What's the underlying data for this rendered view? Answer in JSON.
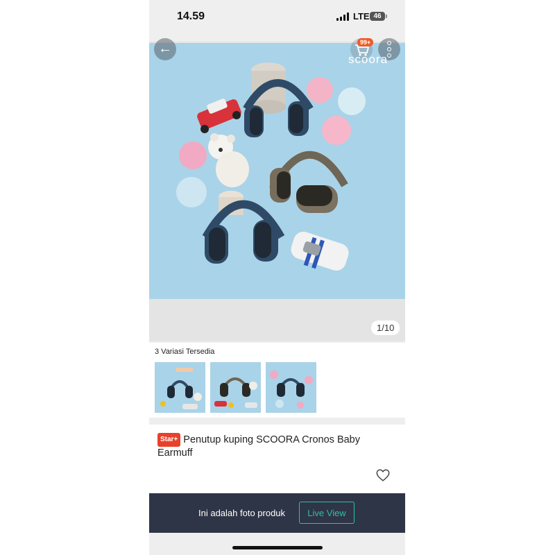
{
  "status_bar": {
    "time": "14.59",
    "network": "LTE",
    "battery": "46"
  },
  "header": {
    "brand": "scoora",
    "cart_badge": "99+"
  },
  "gallery": {
    "page_indicator": "1/10",
    "background_color": "#a9d3e8"
  },
  "variants": {
    "title": "3 Variasi Tersedia",
    "count": 3
  },
  "product": {
    "badge": "Star+",
    "title": "Penutup kuping  SCOORA Cronos Baby Earmuff"
  },
  "banner": {
    "text": "Ini adalah foto produk",
    "live_view_label": "Live View"
  },
  "colors": {
    "badge_red": "#e8402a",
    "cart_badge": "#f05a28",
    "banner_bg": "#2e3547",
    "live_view": "#2fbfa7"
  },
  "icons": [
    "back-arrow-icon",
    "cart-icon",
    "more-options-icon",
    "heart-icon"
  ]
}
